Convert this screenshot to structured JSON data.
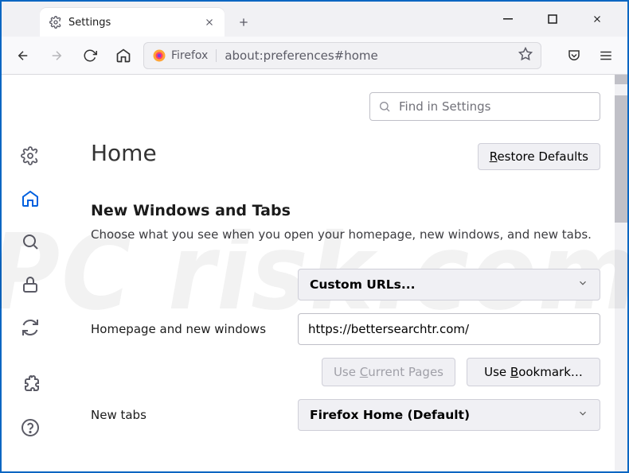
{
  "tab": {
    "title": "Settings"
  },
  "urlbar": {
    "identity_label": "Firefox",
    "address": "about:preferences#home"
  },
  "search": {
    "placeholder": "Find in Settings"
  },
  "page": {
    "heading": "Home",
    "restore_label": "Restore Defaults",
    "section": "New Windows and Tabs",
    "desc": "Choose what you see when you open your homepage, new windows, and new tabs."
  },
  "form": {
    "homepage_label": "Homepage and new windows",
    "homepage_mode": "Custom URLs...",
    "homepage_url": "https://bettersearchtr.com/",
    "use_current": "Use Current Pages",
    "use_bookmark": "Use Bookmark…",
    "newtabs_label": "New tabs",
    "newtabs_mode": "Firefox Home (Default)"
  },
  "watermark": "PC risk.com"
}
